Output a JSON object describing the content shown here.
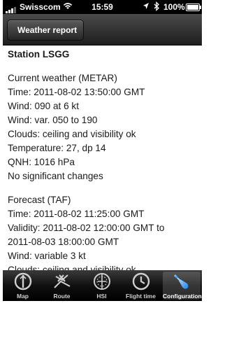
{
  "status_bar": {
    "carrier": "Swisscom",
    "time": "15:59",
    "battery": "100%"
  },
  "nav": {
    "back_label": "Weather report"
  },
  "report": {
    "station": "Station LSGG",
    "metar_heading": "Current weather (METAR)",
    "metar_lines": [
      "Time: 2011-08-02 13:50:00 GMT",
      "Wind: 090 at 6 kt",
      "Wind: var. 050 to 190",
      "Clouds: ceiling and visibility ok",
      "Temperature: 27, dp 14",
      "QNH: 1016 hPa",
      "No significant changes"
    ],
    "taf_heading": "Forecast (TAF)",
    "taf_lines": [
      "Time: 2011-08-02 11:25:00 GMT",
      "Validity: 2011-08-02 12:00:00 GMT to",
      "2011-08-03 18:00:00 GMT",
      "Wind: variable 3 kt",
      "Clouds: ceiling and visibility ok"
    ]
  },
  "tabs": [
    {
      "label": "Map",
      "icon": "map-icon"
    },
    {
      "label": "Route",
      "icon": "route-icon"
    },
    {
      "label": "HSI",
      "icon": "hsi-icon"
    },
    {
      "label": "Flight time",
      "icon": "clock-icon"
    },
    {
      "label": "Configuration",
      "icon": "configuration-icon",
      "active": true
    }
  ]
}
